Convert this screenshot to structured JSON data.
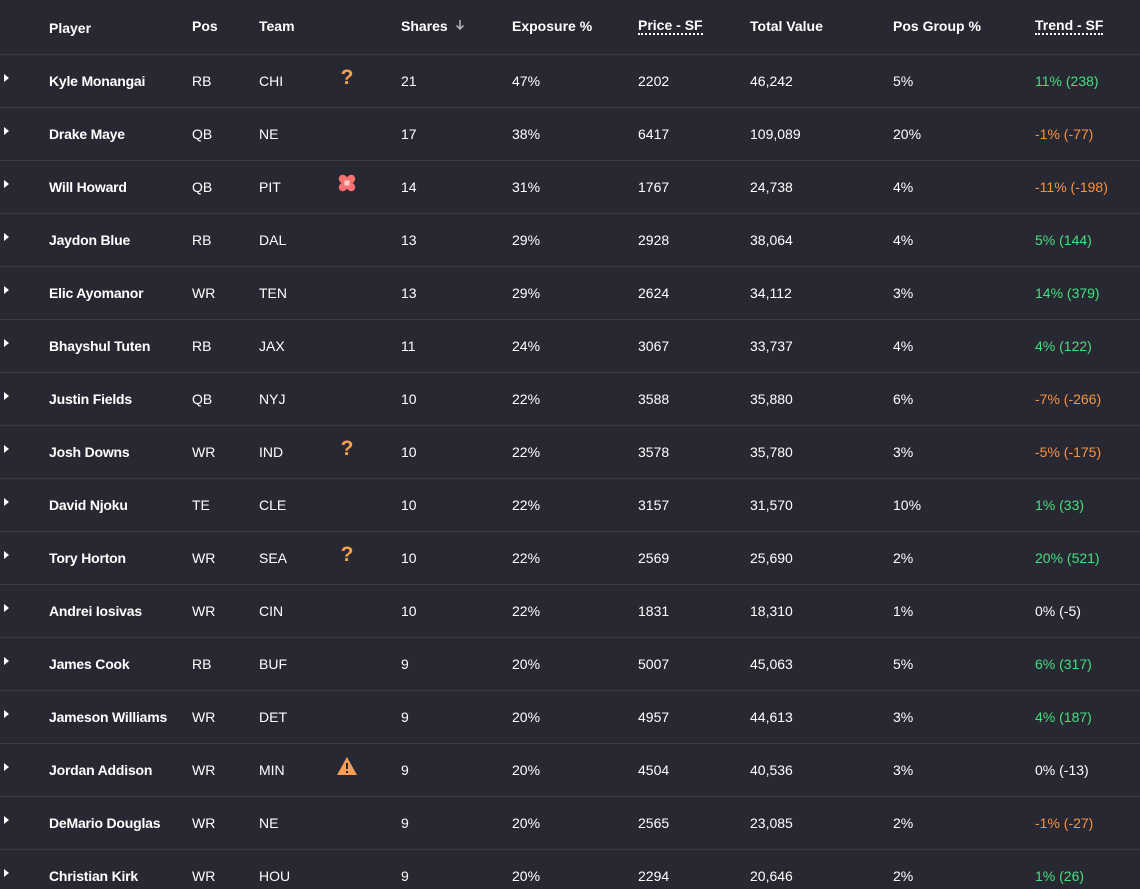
{
  "header": {
    "player": "Player",
    "pos": "Pos",
    "team": "Team",
    "shares": "Shares",
    "exposure": "Exposure %",
    "price": "Price - SF",
    "total_value": "Total Value",
    "pos_group": "Pos Group %",
    "trend": "Trend - SF"
  },
  "colors": {
    "background": "#282833",
    "positive": "#4ade80",
    "negative": "#fb923c",
    "question": "#f5a04c",
    "injury": "#f87171",
    "warning": "#f59e5a"
  },
  "rows": [
    {
      "player": "Kyle Monangai",
      "pos": "RB",
      "team": "CHI",
      "status": "question-icon",
      "shares": "21",
      "exposure": "47%",
      "price": "2202",
      "total": "46,242",
      "pos_group": "5%",
      "trend": "11% (238)",
      "trend_dir": "up"
    },
    {
      "player": "Drake Maye",
      "pos": "QB",
      "team": "NE",
      "status": "",
      "shares": "17",
      "exposure": "38%",
      "price": "6417",
      "total": "109,089",
      "pos_group": "20%",
      "trend": "-1% (-77)",
      "trend_dir": "down"
    },
    {
      "player": "Will Howard",
      "pos": "QB",
      "team": "PIT",
      "status": "bandage-icon",
      "shares": "14",
      "exposure": "31%",
      "price": "1767",
      "total": "24,738",
      "pos_group": "4%",
      "trend": "-11% (-198)",
      "trend_dir": "down"
    },
    {
      "player": "Jaydon Blue",
      "pos": "RB",
      "team": "DAL",
      "status": "",
      "shares": "13",
      "exposure": "29%",
      "price": "2928",
      "total": "38,064",
      "pos_group": "4%",
      "trend": "5% (144)",
      "trend_dir": "up"
    },
    {
      "player": "Elic Ayomanor",
      "pos": "WR",
      "team": "TEN",
      "status": "",
      "shares": "13",
      "exposure": "29%",
      "price": "2624",
      "total": "34,112",
      "pos_group": "3%",
      "trend": "14% (379)",
      "trend_dir": "up"
    },
    {
      "player": "Bhayshul Tuten",
      "pos": "RB",
      "team": "JAX",
      "status": "",
      "shares": "11",
      "exposure": "24%",
      "price": "3067",
      "total": "33,737",
      "pos_group": "4%",
      "trend": "4% (122)",
      "trend_dir": "up"
    },
    {
      "player": "Justin Fields",
      "pos": "QB",
      "team": "NYJ",
      "status": "",
      "shares": "10",
      "exposure": "22%",
      "price": "3588",
      "total": "35,880",
      "pos_group": "6%",
      "trend": "-7% (-266)",
      "trend_dir": "down"
    },
    {
      "player": "Josh Downs",
      "pos": "WR",
      "team": "IND",
      "status": "question-icon",
      "shares": "10",
      "exposure": "22%",
      "price": "3578",
      "total": "35,780",
      "pos_group": "3%",
      "trend": "-5% (-175)",
      "trend_dir": "down"
    },
    {
      "player": "David Njoku",
      "pos": "TE",
      "team": "CLE",
      "status": "",
      "shares": "10",
      "exposure": "22%",
      "price": "3157",
      "total": "31,570",
      "pos_group": "10%",
      "trend": "1% (33)",
      "trend_dir": "up"
    },
    {
      "player": "Tory Horton",
      "pos": "WR",
      "team": "SEA",
      "status": "question-icon",
      "shares": "10",
      "exposure": "22%",
      "price": "2569",
      "total": "25,690",
      "pos_group": "2%",
      "trend": "20% (521)",
      "trend_dir": "up"
    },
    {
      "player": "Andrei Iosivas",
      "pos": "WR",
      "team": "CIN",
      "status": "",
      "shares": "10",
      "exposure": "22%",
      "price": "1831",
      "total": "18,310",
      "pos_group": "1%",
      "trend": "0% (-5)",
      "trend_dir": "flat"
    },
    {
      "player": "James Cook",
      "pos": "RB",
      "team": "BUF",
      "status": "",
      "shares": "9",
      "exposure": "20%",
      "price": "5007",
      "total": "45,063",
      "pos_group": "5%",
      "trend": "6% (317)",
      "trend_dir": "up"
    },
    {
      "player": "Jameson Williams",
      "pos": "WR",
      "team": "DET",
      "status": "",
      "shares": "9",
      "exposure": "20%",
      "price": "4957",
      "total": "44,613",
      "pos_group": "3%",
      "trend": "4% (187)",
      "trend_dir": "up"
    },
    {
      "player": "Jordan Addison",
      "pos": "WR",
      "team": "MIN",
      "status": "warning-icon",
      "shares": "9",
      "exposure": "20%",
      "price": "4504",
      "total": "40,536",
      "pos_group": "3%",
      "trend": "0% (-13)",
      "trend_dir": "flat"
    },
    {
      "player": "DeMario Douglas",
      "pos": "WR",
      "team": "NE",
      "status": "",
      "shares": "9",
      "exposure": "20%",
      "price": "2565",
      "total": "23,085",
      "pos_group": "2%",
      "trend": "-1% (-27)",
      "trend_dir": "down"
    },
    {
      "player": "Christian Kirk",
      "pos": "WR",
      "team": "HOU",
      "status": "",
      "shares": "9",
      "exposure": "20%",
      "price": "2294",
      "total": "20,646",
      "pos_group": "2%",
      "trend": "1% (26)",
      "trend_dir": "up"
    }
  ]
}
